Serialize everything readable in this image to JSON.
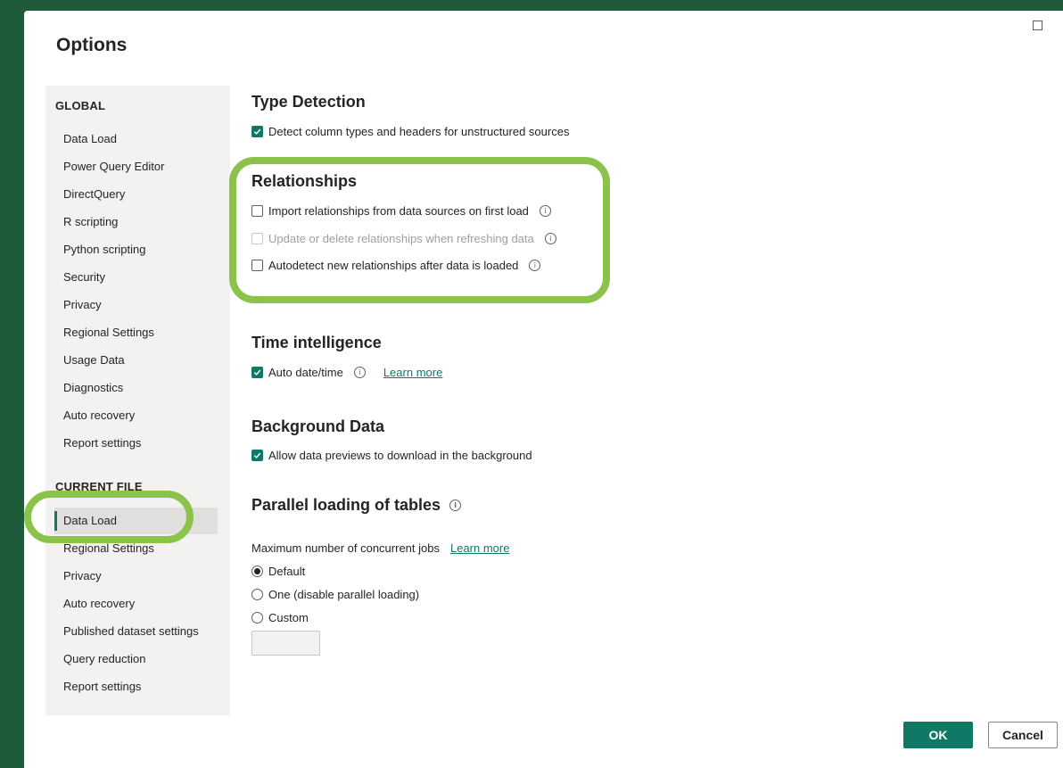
{
  "dialog": {
    "title": "Options",
    "ok_label": "OK",
    "cancel_label": "Cancel"
  },
  "sidebar": {
    "global_heading": "GLOBAL",
    "global_items": [
      "Data Load",
      "Power Query Editor",
      "DirectQuery",
      "R scripting",
      "Python scripting",
      "Security",
      "Privacy",
      "Regional Settings",
      "Usage Data",
      "Diagnostics",
      "Auto recovery",
      "Report settings"
    ],
    "current_heading": "CURRENT FILE",
    "current_items": [
      "Data Load",
      "Regional Settings",
      "Privacy",
      "Auto recovery",
      "Published dataset settings",
      "Query reduction",
      "Report settings"
    ],
    "selected": "Data Load"
  },
  "type_detection": {
    "title": "Type Detection",
    "detect_label": "Detect column types and headers for unstructured sources",
    "detect_checked": true
  },
  "relationships": {
    "title": "Relationships",
    "import_label": "Import relationships from data sources on first load",
    "update_label": "Update or delete relationships when refreshing data",
    "autodetect_label": "Autodetect new relationships after data is loaded"
  },
  "time_intelligence": {
    "title": "Time intelligence",
    "auto_label": "Auto date/time",
    "learn_more": "Learn more"
  },
  "background_data": {
    "title": "Background Data",
    "allow_label": "Allow data previews to download in the background"
  },
  "parallel_loading": {
    "title": "Parallel loading of tables",
    "max_jobs_label": "Maximum number of concurrent jobs",
    "learn_more": "Learn more",
    "options": [
      "Default",
      "One (disable parallel loading)",
      "Custom"
    ],
    "selected": "Default"
  },
  "info_glyph": "i",
  "colors": {
    "accent": "#117865",
    "highlight": "#8bc34a",
    "background": "#1f5a3a"
  }
}
